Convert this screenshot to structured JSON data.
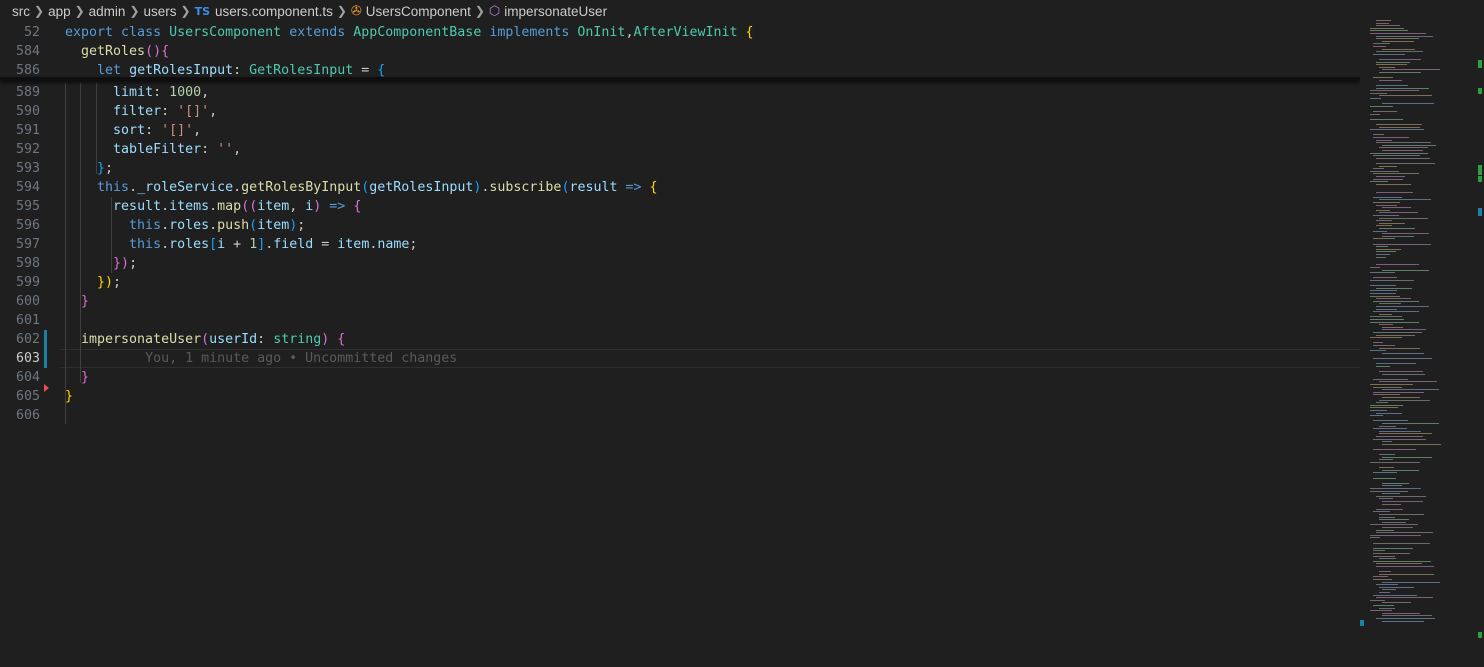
{
  "breadcrumb": {
    "items": [
      "src",
      "app",
      "admin",
      "users"
    ],
    "file_badge": "TS",
    "file": "users.component.ts",
    "class_name": "UsersComponent",
    "method_name": "impersonateUser"
  },
  "editor": {
    "lines": [
      {
        "num": "52",
        "tokens": [
          [
            "kw",
            "export "
          ],
          [
            "kw",
            "class "
          ],
          [
            "cls",
            "UsersComponent "
          ],
          [
            "kw",
            "extends "
          ],
          [
            "cls",
            "AppComponentBase "
          ],
          [
            "kw",
            "implements "
          ],
          [
            "cls",
            "OnInit"
          ],
          [
            "",
            ","
          ],
          [
            "cls",
            "AfterViewInit "
          ],
          [
            "b1",
            "{"
          ]
        ]
      },
      {
        "num": "584",
        "tokens": [
          [
            "",
            "  "
          ],
          [
            "fn",
            "getRoles"
          ],
          [
            "b2",
            "()"
          ],
          [
            "",
            "",
            " "
          ],
          [
            "b2",
            "{"
          ]
        ]
      },
      {
        "num": "586",
        "tokens": [
          [
            "",
            "    "
          ],
          [
            "kw",
            "let "
          ],
          [
            "var",
            "getRolesInput"
          ],
          [
            "",
            ": "
          ],
          [
            "cls",
            "GetRolesInput"
          ],
          [
            "",
            " = "
          ],
          [
            "b3",
            "{"
          ]
        ]
      },
      {
        "num": "589",
        "tokens": [
          [
            "",
            "      "
          ],
          [
            "var",
            "limit"
          ],
          [
            "",
            ": "
          ],
          [
            "num",
            "1000"
          ],
          [
            "",
            ","
          ]
        ]
      },
      {
        "num": "590",
        "tokens": [
          [
            "",
            "      "
          ],
          [
            "var",
            "filter"
          ],
          [
            "",
            ": "
          ],
          [
            "str",
            "'[]'"
          ],
          [
            "",
            ","
          ]
        ]
      },
      {
        "num": "591",
        "tokens": [
          [
            "",
            "      "
          ],
          [
            "var",
            "sort"
          ],
          [
            "",
            ": "
          ],
          [
            "str",
            "'[]'"
          ],
          [
            "",
            ","
          ]
        ]
      },
      {
        "num": "592",
        "tokens": [
          [
            "",
            "      "
          ],
          [
            "var",
            "tableFilter"
          ],
          [
            "",
            ": "
          ],
          [
            "str",
            "''"
          ],
          [
            "",
            ","
          ]
        ]
      },
      {
        "num": "593",
        "tokens": [
          [
            "",
            "    "
          ],
          [
            "b3",
            "}"
          ],
          [
            "",
            ";"
          ]
        ]
      },
      {
        "num": "594",
        "tokens": [
          [
            "",
            "    "
          ],
          [
            "kw",
            "this"
          ],
          [
            "",
            "."
          ],
          [
            "var",
            "_roleService"
          ],
          [
            "",
            "."
          ],
          [
            "fn",
            "getRolesByInput"
          ],
          [
            "b3",
            "("
          ],
          [
            "var",
            "getRolesInput"
          ],
          [
            "b3",
            ")"
          ],
          [
            "",
            "."
          ],
          [
            "fn",
            "subscribe"
          ],
          [
            "b3",
            "("
          ],
          [
            "var",
            "result "
          ],
          [
            "kw",
            "=> "
          ],
          [
            "b1",
            "{"
          ]
        ]
      },
      {
        "num": "595",
        "tokens": [
          [
            "",
            "      "
          ],
          [
            "var",
            "result"
          ],
          [
            "",
            "."
          ],
          [
            "var",
            "items"
          ],
          [
            "",
            "."
          ],
          [
            "fn",
            "map"
          ],
          [
            "b2",
            "(("
          ],
          [
            "var",
            "item"
          ],
          [
            "",
            ", "
          ],
          [
            "var",
            "i"
          ],
          [
            "b2",
            ") "
          ],
          [
            "kw",
            "=> "
          ],
          [
            "b2",
            "{"
          ]
        ]
      },
      {
        "num": "596",
        "tokens": [
          [
            "",
            "        "
          ],
          [
            "kw",
            "this"
          ],
          [
            "",
            "."
          ],
          [
            "var",
            "roles"
          ],
          [
            "",
            "."
          ],
          [
            "fn",
            "push"
          ],
          [
            "b3",
            "("
          ],
          [
            "var",
            "item"
          ],
          [
            "b3",
            ")"
          ],
          [
            "",
            ";"
          ]
        ]
      },
      {
        "num": "597",
        "tokens": [
          [
            "",
            "        "
          ],
          [
            "kw",
            "this"
          ],
          [
            "",
            "."
          ],
          [
            "var",
            "roles"
          ],
          [
            "b3",
            "["
          ],
          [
            "var",
            "i"
          ],
          [
            "",
            " + "
          ],
          [
            "num",
            "1"
          ],
          [
            "b3",
            "]"
          ],
          [
            "",
            "."
          ],
          [
            "var",
            "field"
          ],
          [
            "",
            " = "
          ],
          [
            "var",
            "item"
          ],
          [
            "",
            "."
          ],
          [
            "var",
            "name"
          ],
          [
            "",
            ";"
          ]
        ]
      },
      {
        "num": "598",
        "tokens": [
          [
            "",
            "      "
          ],
          [
            "b2",
            "})"
          ],
          [
            "",
            ";"
          ]
        ]
      },
      {
        "num": "599",
        "tokens": [
          [
            "",
            "    "
          ],
          [
            "b1",
            "})"
          ],
          [
            "",
            ";"
          ]
        ]
      },
      {
        "num": "600",
        "tokens": [
          [
            "",
            "  "
          ],
          [
            "b2",
            "}"
          ]
        ]
      },
      {
        "num": "601",
        "tokens": []
      },
      {
        "num": "602",
        "tokens": [
          [
            "",
            "  "
          ],
          [
            "fn",
            "impersonateUser"
          ],
          [
            "b2",
            "("
          ],
          [
            "var",
            "userId"
          ],
          [
            "",
            ": "
          ],
          [
            "cls",
            "string"
          ],
          [
            "b2",
            ") "
          ],
          [
            "b2",
            "{"
          ]
        ]
      },
      {
        "num": "603",
        "tokens": [
          [
            "",
            "          "
          ],
          [
            "blame",
            "You, 1 minute ago • Uncommitted changes"
          ]
        ]
      },
      {
        "num": "604",
        "tokens": [
          [
            "",
            "  "
          ],
          [
            "b2",
            "}"
          ]
        ]
      },
      {
        "num": "605",
        "tokens": [
          [
            "b1",
            "}"
          ]
        ]
      },
      {
        "num": "606",
        "tokens": []
      }
    ],
    "active_line": "603"
  }
}
